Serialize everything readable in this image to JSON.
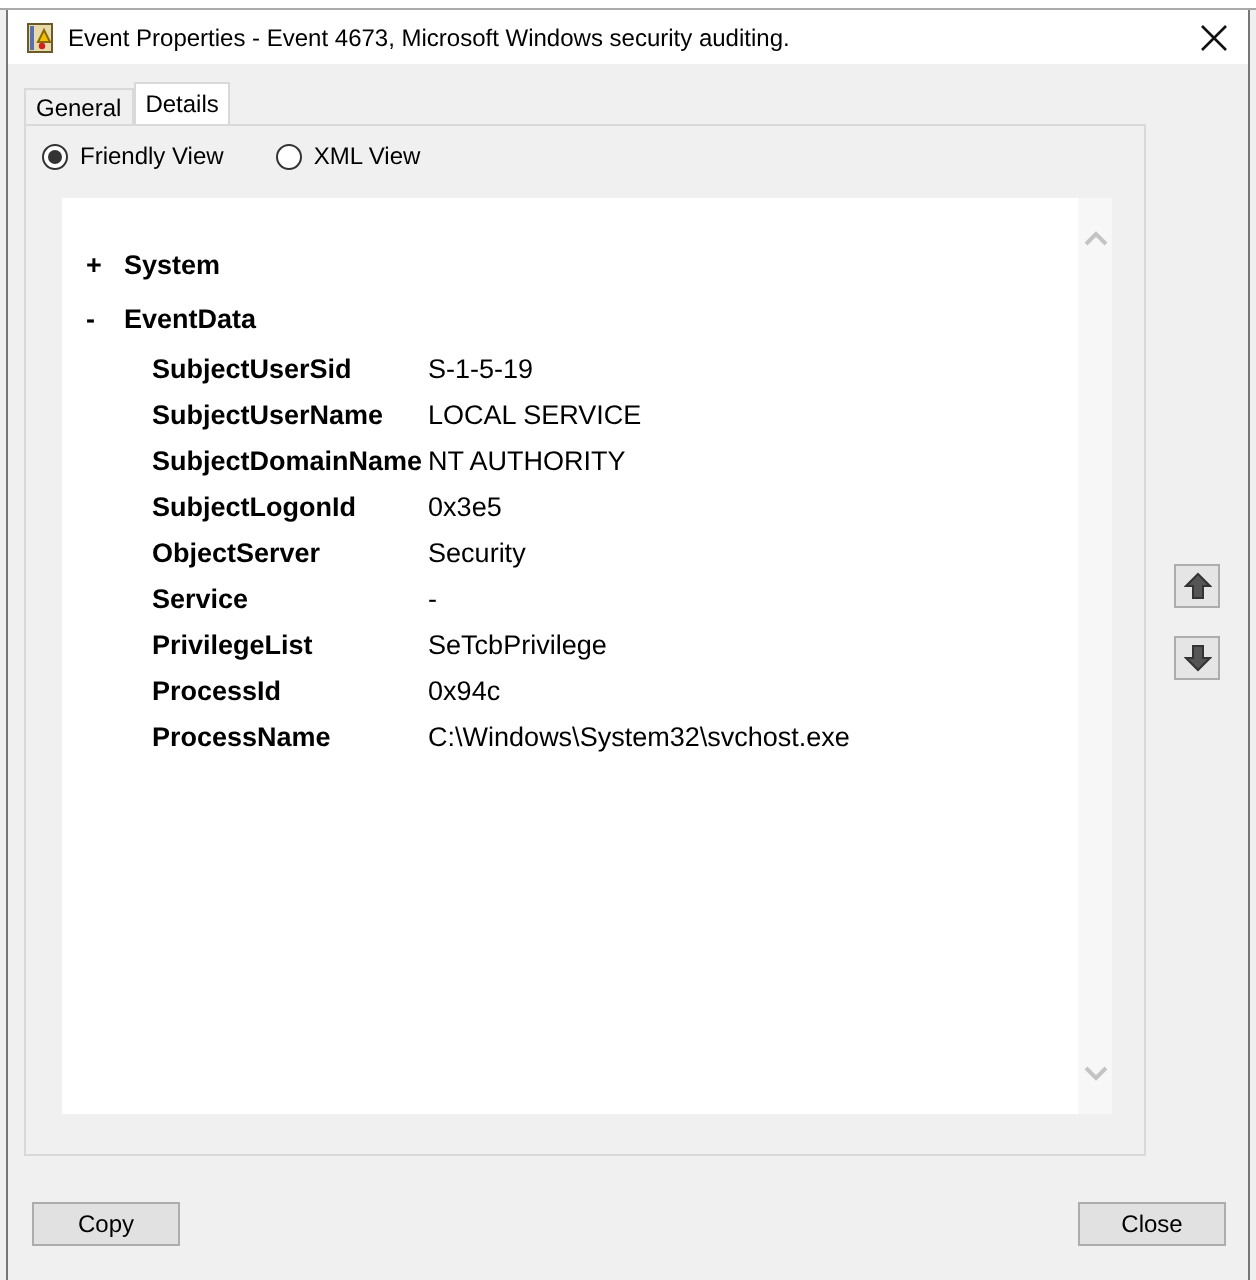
{
  "window": {
    "title": "Event Properties - Event 4673, Microsoft Windows security auditing."
  },
  "tabs": [
    {
      "label": "General",
      "selected": false
    },
    {
      "label": "Details",
      "selected": true
    }
  ],
  "views": [
    {
      "label": "Friendly View",
      "selected": true
    },
    {
      "label": "XML View",
      "selected": false
    }
  ],
  "tree": [
    {
      "toggle": "+",
      "label": "System"
    },
    {
      "toggle": "-",
      "label": "EventData",
      "fields": [
        {
          "name": "SubjectUserSid",
          "value": "S-1-5-19"
        },
        {
          "name": "SubjectUserName",
          "value": "LOCAL SERVICE"
        },
        {
          "name": "SubjectDomainName",
          "value": "NT AUTHORITY"
        },
        {
          "name": "SubjectLogonId",
          "value": "0x3e5"
        },
        {
          "name": "ObjectServer",
          "value": "Security"
        },
        {
          "name": "Service",
          "value": "-"
        },
        {
          "name": "PrivilegeList",
          "value": "SeTcbPrivilege"
        },
        {
          "name": "ProcessId",
          "value": "0x94c"
        },
        {
          "name": "ProcessName",
          "value": "C:\\Windows\\System32\\svchost.exe"
        }
      ]
    }
  ],
  "buttons": [
    {
      "label": "Copy"
    },
    {
      "label": "Close"
    }
  ]
}
